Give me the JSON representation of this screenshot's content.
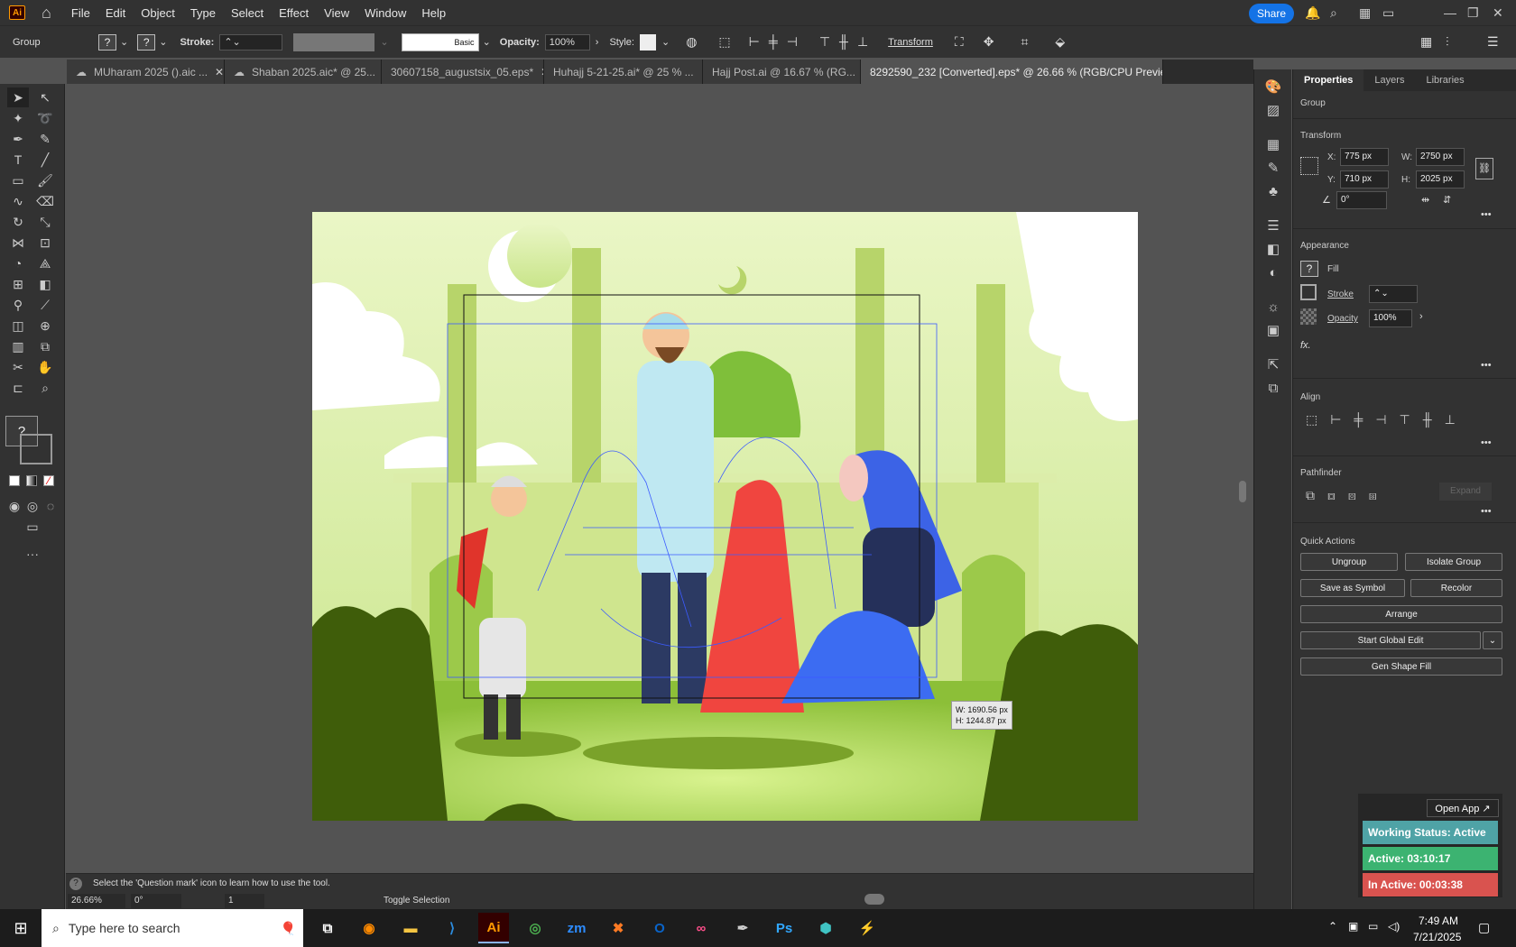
{
  "menubar": {
    "app_logo": "Ai",
    "items": [
      "File",
      "Edit",
      "Object",
      "Type",
      "Select",
      "Effect",
      "View",
      "Window",
      "Help"
    ],
    "share_label": "Share"
  },
  "control": {
    "selection_label": "Group",
    "stroke_label": "Stroke:",
    "brush_label": "Basic",
    "opacity_label": "Opacity:",
    "opacity_value": "100%",
    "style_label": "Style:",
    "transform_label": "Transform"
  },
  "tabs": [
    {
      "label": "MUharam 2025 ().aic ...",
      "cloud": true
    },
    {
      "label": "Shaban 2025.aic* @ 25...",
      "cloud": true
    },
    {
      "label": "30607158_augustsix_05.eps*",
      "cloud": false
    },
    {
      "label": "Huhajj 5-21-25.ai* @ 25 % ...",
      "cloud": false
    },
    {
      "label": "Hajj Post.ai @ 16.67 % (RG...",
      "cloud": false
    },
    {
      "label": "8292590_232 [Converted].eps* @ 26.66 % (RGB/CPU Preview)",
      "cloud": false,
      "active": true
    }
  ],
  "properties": {
    "tabs": [
      "Properties",
      "Layers",
      "Libraries"
    ],
    "object_type": "Group",
    "transform": {
      "title": "Transform",
      "x_label": "X:",
      "x": "775 px",
      "y_label": "Y:",
      "y": "710 px",
      "w_label": "W:",
      "w": "2750 px",
      "h_label": "H:",
      "h": "2025 px",
      "angle": "0°"
    },
    "appearance": {
      "title": "Appearance",
      "fill": "Fill",
      "stroke": "Stroke",
      "opacity": "Opacity",
      "opacity_value": "100%",
      "fx": "fx."
    },
    "align_title": "Align",
    "pathfinder": {
      "title": "Pathfinder",
      "expand": "Expand"
    },
    "quick_actions": {
      "title": "Quick Actions",
      "ungroup": "Ungroup",
      "isolate": "Isolate Group",
      "save_symbol": "Save as Symbol",
      "recolor": "Recolor",
      "arrange": "Arrange",
      "global_edit": "Start Global Edit",
      "gen_shape": "Gen Shape Fill"
    }
  },
  "canvas": {
    "size_tooltip_w": "W: 1690.56 px",
    "size_tooltip_h": "H: 1244.87 px"
  },
  "status": {
    "hint": "Select the 'Question mark' icon to learn how to use the tool.",
    "zoom": "26.66%",
    "rotation": "0°",
    "artboard": "1",
    "toggle": "Toggle Selection"
  },
  "timer_widget": {
    "open_app": "Open App ↗",
    "working": "Working Status: Active",
    "active": "Active: 03:10:17",
    "inactive": "In Active: 00:03:38",
    "colors": {
      "working": "#4fa3a6",
      "active": "#3cb371",
      "inactive": "#d9534f"
    }
  },
  "taskbar": {
    "search_placeholder": "Type here to search",
    "time": "7:49 AM",
    "date": "7/21/2025",
    "apps": [
      "Firefox",
      "File Explorer",
      "VS Code",
      "Illustrator",
      "Chrome",
      "Zoom",
      "XAMPP",
      "Outlook",
      "Creative Cloud",
      "Tool",
      "Photoshop",
      "App",
      "App"
    ]
  }
}
